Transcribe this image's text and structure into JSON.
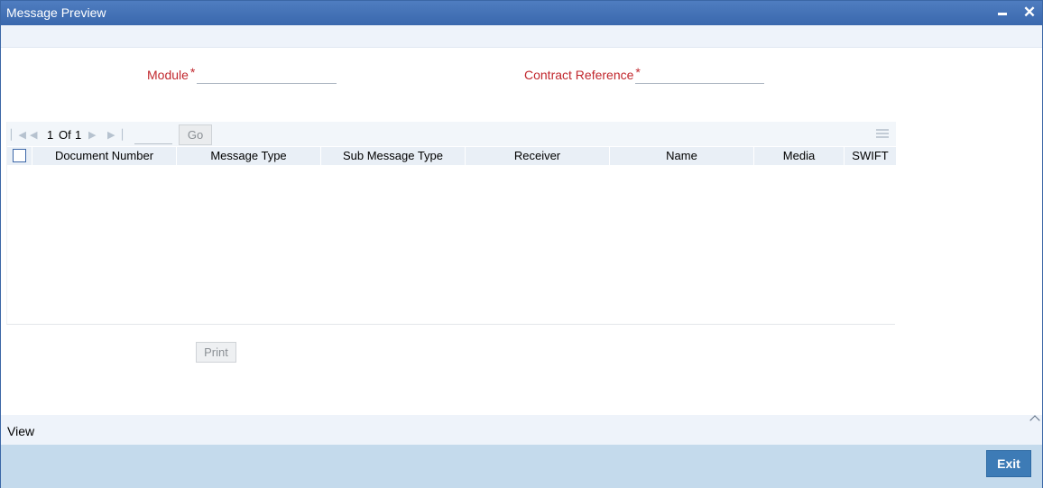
{
  "window": {
    "title": "Message Preview"
  },
  "form": {
    "module_label": "Module",
    "module_value": "",
    "contract_label": "Contract Reference",
    "contract_value": "",
    "required_mark": "*"
  },
  "pager": {
    "current": "1",
    "of_label": "Of",
    "total": "1",
    "page_input": "",
    "go_label": "Go"
  },
  "table": {
    "columns": [
      "Document Number",
      "Message Type",
      "Sub Message Type",
      "Receiver",
      "Name",
      "Media",
      "SWIFT"
    ],
    "rows": []
  },
  "actions": {
    "print_label": "Print",
    "exit_label": "Exit"
  },
  "view_bar": {
    "label": "View"
  },
  "colors": {
    "title_bar": "#3f6db2",
    "required_label": "#c1272d",
    "footer": "#c4daec",
    "exit_button": "#3d7bb6"
  }
}
